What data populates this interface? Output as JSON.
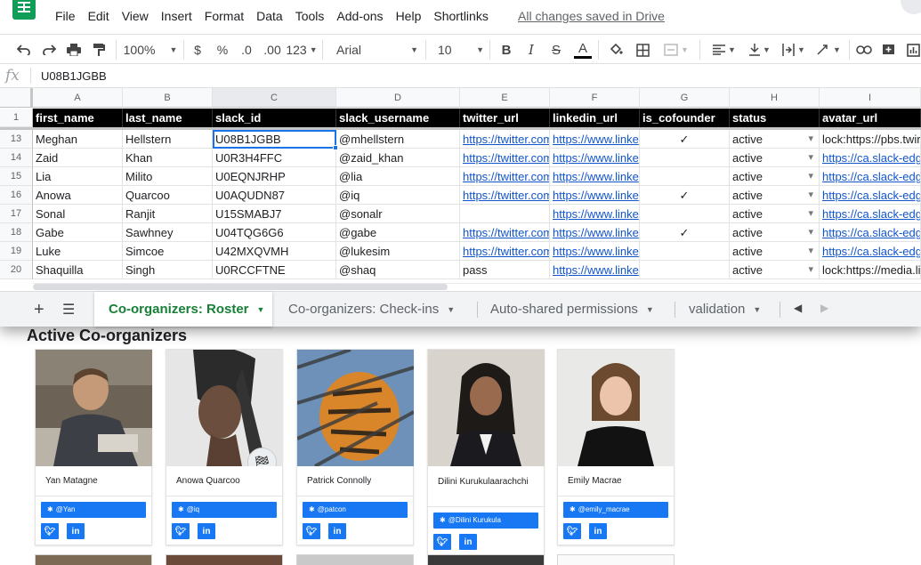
{
  "menu": [
    "File",
    "Edit",
    "View",
    "Insert",
    "Format",
    "Data",
    "Tools",
    "Add-ons",
    "Help",
    "Shortlinks"
  ],
  "saved_status": "All changes saved in Drive",
  "toolbar": {
    "zoom": "100%",
    "currency": "$",
    "percent": "%",
    "dec_less": ".0",
    "dec_more": ".00",
    "more_formats": "123",
    "font": "Arial",
    "font_size": "10",
    "bold": "B",
    "italic": "I",
    "strike": "S",
    "text_color": "A"
  },
  "formula_bar": {
    "fx": "fx",
    "value": "U08B1JGBB"
  },
  "columns": [
    "A",
    "B",
    "C",
    "D",
    "E",
    "F",
    "G",
    "H",
    "I"
  ],
  "header_row": {
    "number": "1",
    "cells": [
      "first_name",
      "last_name",
      "slack_id",
      "slack_username",
      "twitter_url",
      "linkedin_url",
      "is_cofounder",
      "status",
      "avatar_url"
    ]
  },
  "rows": [
    {
      "number": "13",
      "cells": [
        "Meghan",
        "Hellstern",
        "U08B1JGBB",
        "@mhellstern",
        "https://twitter.com",
        "https://www.linke",
        "✓",
        "active",
        "lock:https://pbs.twir"
      ]
    },
    {
      "number": "14",
      "cells": [
        "Zaid",
        "Khan",
        "U0R3H4FFC",
        "@zaid_khan",
        "https://twitter.com",
        "https://www.linke",
        "",
        "active",
        "https://ca.slack-edg"
      ]
    },
    {
      "number": "15",
      "cells": [
        "Lia",
        "Milito",
        "U0EQNJRHP",
        "@lia",
        "https://twitter.com",
        "https://www.linke",
        "",
        "active",
        "https://ca.slack-edg"
      ]
    },
    {
      "number": "16",
      "cells": [
        "Anowa",
        "Quarcoo",
        "U0AQUDN87",
        "@iq",
        "https://twitter.com",
        "https://www.linke",
        "✓",
        "active",
        "https://ca.slack-edg"
      ]
    },
    {
      "number": "17",
      "cells": [
        "Sonal",
        "Ranjit",
        "U15SMABJ7",
        "@sonalr",
        "",
        "https://www.linke",
        "",
        "active",
        "https://ca.slack-edg"
      ]
    },
    {
      "number": "18",
      "cells": [
        "Gabe",
        "Sawhney",
        "U04TQG6G6",
        "@gabe",
        "https://twitter.com",
        "https://www.linke",
        "✓",
        "active",
        "https://ca.slack-edg"
      ]
    },
    {
      "number": "19",
      "cells": [
        "Luke",
        "Simcoe",
        "U42MXQVMH",
        "@lukesim",
        "https://twitter.com",
        "https://www.linke",
        "",
        "active",
        "https://ca.slack-edg"
      ]
    },
    {
      "number": "20",
      "cells": [
        "Shaquilla",
        "Singh",
        "U0RCCFTNE",
        "@shaq",
        "pass",
        "https://www.linke",
        "",
        "active",
        "lock:https://media.li"
      ]
    }
  ],
  "sheet_tabs": [
    "Co-organizers: Roster",
    "Co-organizers: Check-ins",
    "Auto-shared permissions",
    "validation"
  ],
  "page": {
    "title": "Active Co-organizers",
    "cards": [
      {
        "name": "Yan Matagne",
        "slack": "@Yan"
      },
      {
        "name": "Anowa Quarcoo",
        "slack": "@iq"
      },
      {
        "name": "Patrick Connolly",
        "slack": "@patcon"
      },
      {
        "name": "Dilini Kurukulaarachchi",
        "slack": "@Dilini Kurukula"
      },
      {
        "name": "Emily Macrae",
        "slack": "@emily_macrae"
      }
    ]
  },
  "colors": {
    "accent": "#1a73e8",
    "sheets_green": "#0f9d58",
    "active_tab": "#188038",
    "link": "#1155cc",
    "social_blue": "#1877f2"
  }
}
